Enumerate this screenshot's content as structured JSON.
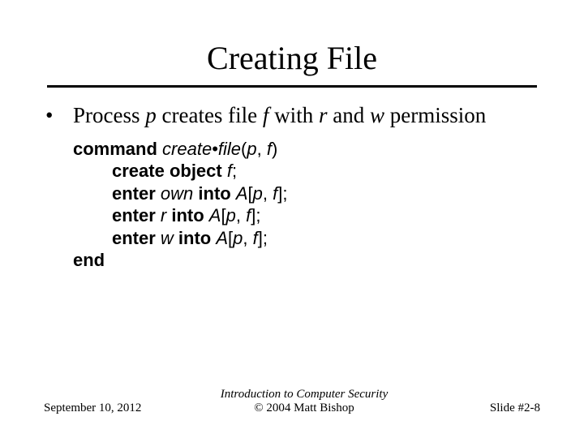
{
  "title": "Creating File",
  "bullet": {
    "pre1": "Process ",
    "p": "p",
    "mid1": " creates file ",
    "f": "f",
    "mid2": " with ",
    "r": "r",
    "mid3": " and ",
    "w": "w",
    "post": " permission"
  },
  "code": {
    "l1_kw": "command",
    "l1_fn": " create•file",
    "l1_open": "(",
    "l1_args_p": "p",
    "l1_comma": ", ",
    "l1_args_f": "f",
    "l1_close": ")",
    "l2_kw": "create object ",
    "l2_obj": "f",
    "l2_semi": ";",
    "l3_kw": "enter ",
    "l3_own": "own",
    "l3_into": " into ",
    "l3_A": "A",
    "l3_open": "[",
    "l3_p": "p",
    "l3_comma": ", ",
    "l3_f": "f",
    "l3_close": "];",
    "l4_kw": "enter ",
    "l4_r": "r",
    "l4_into": " into ",
    "l4_A": "A",
    "l4_open": "[",
    "l4_p": "p",
    "l4_comma": ", ",
    "l4_f": "f",
    "l4_close": "];",
    "l5_kw": "enter ",
    "l5_w": "w",
    "l5_into": " into ",
    "l5_A": "A",
    "l5_open": "[",
    "l5_p": "p",
    "l5_comma": ", ",
    "l5_f": "f",
    "l5_close": "];",
    "l6_kw": "end"
  },
  "footer": {
    "date": "September 10, 2012",
    "book": "Introduction to Computer Security",
    "copyright": "© 2004 Matt Bishop",
    "slide": "Slide #2-8"
  }
}
